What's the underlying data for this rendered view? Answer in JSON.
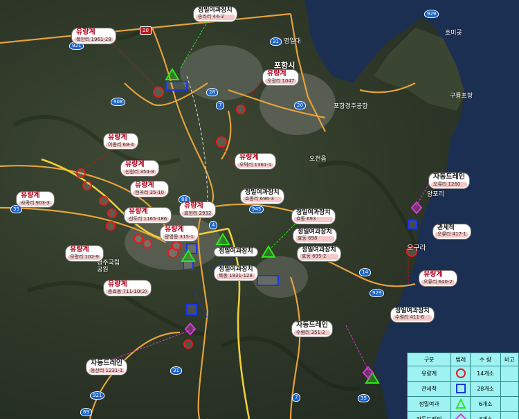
{
  "colors": {
    "rain_gauge": "#e21c1c",
    "water_level": "#1c37e2",
    "precision_station": "#2ee81c",
    "auto_drain": "#d63bd6",
    "road": "#e7a23b",
    "water": "#1b2f52",
    "legend_bg": "#9ff2f2"
  },
  "labels": [
    {
      "title": "유량계",
      "addr": "북안리 1961-28"
    },
    {
      "title": "정밀여과장치",
      "addr": "송라리 44-3"
    },
    {
      "title": "유량계",
      "addr": "오광리 1047"
    },
    {
      "title": "유량계",
      "addr": "이동리 69-4"
    },
    {
      "title": "유량계",
      "addr": "신원리 354-8"
    },
    {
      "title": "유량계",
      "addr": "현곡리 35-10"
    },
    {
      "title": "유량계",
      "addr": "사곡리 903-3"
    },
    {
      "title": "유량계",
      "addr": "오덕리 1361-1"
    },
    {
      "title": "정밀여과장치",
      "addr": "효동리 696-3"
    },
    {
      "title": "유량계",
      "addr": "효현리 2932"
    },
    {
      "title": "유량계",
      "addr": "선도리 1165-186"
    },
    {
      "title": "유량계",
      "addr": "광명동 315-1"
    },
    {
      "title": "유량계",
      "addr": "모량리 102-9"
    },
    {
      "title": "정밀여과장치",
      "addr": "효동 693"
    },
    {
      "title": "정밀여과장치",
      "addr": "효동 698"
    },
    {
      "title": "정밀여과장치",
      "addr": "효동 695-2"
    },
    {
      "title": "정밀여과장치",
      "addr": ""
    },
    {
      "title": "정밀여과장치",
      "addr": "북동 1931-128"
    },
    {
      "title": "유량계",
      "addr": "충효동 711-10(2)"
    },
    {
      "title": "자동드레인",
      "addr": "수렴리 351-2"
    },
    {
      "title": "정밀여과장치",
      "addr": "수렴리 411-6"
    },
    {
      "title": "자동드레인",
      "addr": "동산리 1231-1"
    },
    {
      "title": "자동드레인",
      "addr": "오류리 1260"
    },
    {
      "title": "유량계",
      "addr": "오류리 640-2"
    },
    {
      "title": "관세척",
      "addr": "오류리 417-1"
    }
  ],
  "places": {
    "pohang_city": "포항시",
    "yeongildae": "영일대",
    "homigot": "호미곶",
    "guryongpo": "구룡포항",
    "pohang_port": "포항경주공항",
    "ogori": "오구라",
    "national_park": "경주국립공원",
    "ocheon": "오천읍",
    "yangpo": "양포리"
  },
  "roads": [
    "929",
    "20",
    "921",
    "31",
    "20",
    "908",
    "7",
    "28",
    "945",
    "88",
    "4",
    "14",
    "929",
    "921",
    "31",
    "69",
    "35",
    "7",
    "35"
  ],
  "legend": {
    "headers": [
      "구분",
      "범례",
      "수 량",
      "비고"
    ],
    "rows": [
      {
        "name": "유량계",
        "icon": "circle",
        "count": "14개소"
      },
      {
        "name": "관세척",
        "icon": "square",
        "count": "28개소"
      },
      {
        "name": "정밀여과",
        "icon": "triangle",
        "count": "6개소"
      },
      {
        "name": "자동드레인",
        "icon": "diamond",
        "count": "3개소"
      }
    ]
  }
}
